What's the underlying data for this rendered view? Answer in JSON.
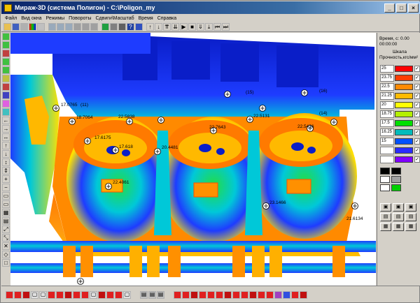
{
  "window": {
    "title": "Мираж-3D (система Полигон) - C:\\Poligon_my",
    "min_label": "_",
    "max_label": "□",
    "close_label": "×"
  },
  "menu": [
    "Файл",
    "Вид окна",
    "Режимы",
    "Повороты",
    "Сдвиги\\Масштаб",
    "Время",
    "Справка"
  ],
  "panel": {
    "time_label": "Время, с: 0.00",
    "time_value": "00:00:00",
    "scale_label": "Шкала",
    "property_label": "Прочность,кгс/мм²",
    "legend": [
      {
        "value": "25",
        "color": "#ff0000"
      },
      {
        "value": "23.75",
        "color": "#ff3d00"
      },
      {
        "value": "22.5",
        "color": "#ff8a00"
      },
      {
        "value": "21.25",
        "color": "#ffbb00"
      },
      {
        "value": "20",
        "color": "#ffff00"
      },
      {
        "value": "18.75",
        "color": "#b4f000"
      },
      {
        "value": "17.5",
        "color": "#00e000"
      },
      {
        "value": "16.25",
        "color": "#00bcbc"
      },
      {
        "value": "15",
        "color": "#0050ff"
      },
      {
        "value": "",
        "color": "#2a2aff"
      },
      {
        "value": "",
        "color": "#8000ff"
      }
    ]
  },
  "probe_labels": [
    "17.0765",
    "(11)",
    "18.7064",
    "22.5838",
    "17.618",
    "(15)",
    "22.7643",
    "(16)",
    "22.5131",
    "22.5436",
    "(14)",
    "20.4481",
    "17.6175",
    "22.4061",
    "23.1466",
    "21.6134"
  ],
  "colors": {
    "blue": "#1e3cff",
    "deep_blue": "#0a1ec8",
    "orange": "#ff7a00",
    "yellow": "#ffe200",
    "green": "#22dd44",
    "cyan": "#00c8d8",
    "red": "#ff2a00"
  }
}
